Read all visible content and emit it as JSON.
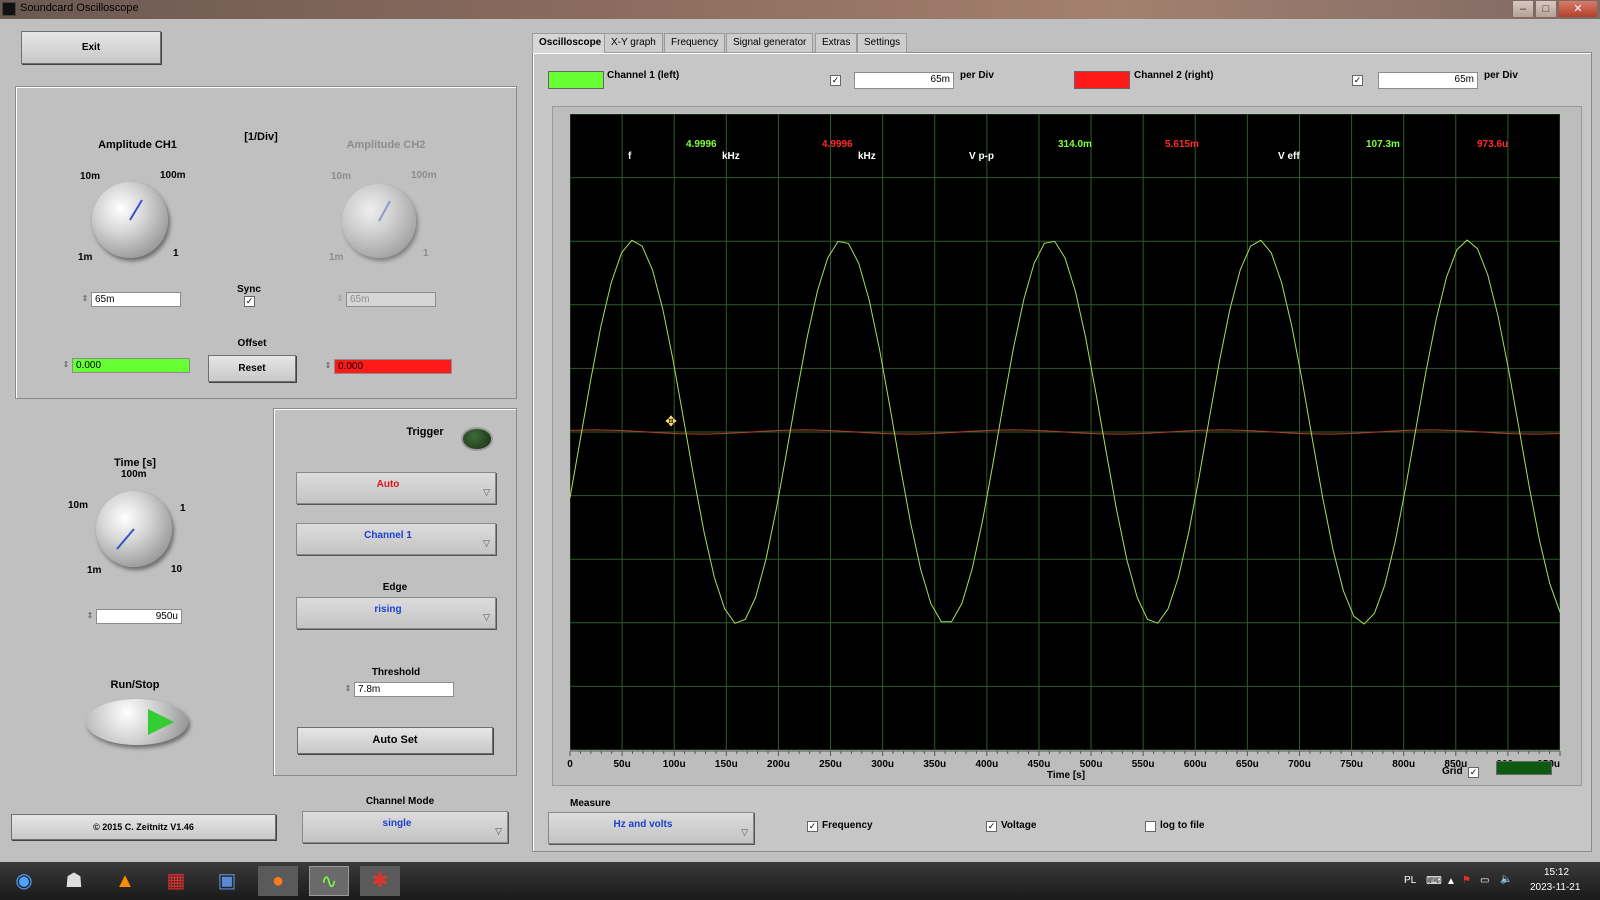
{
  "window": {
    "title": "Soundcard Oscilloscope"
  },
  "left": {
    "exit_label": "Exit",
    "amp_ch1": {
      "title": "Amplitude CH1",
      "t10m": "10m",
      "t100m": "100m",
      "t1m": "1m",
      "t1": "1",
      "value": "65m"
    },
    "per_div": "[1/Div]",
    "amp_ch2": {
      "title": "Amplitude CH2",
      "t10m": "10m",
      "t100m": "100m",
      "t1m": "1m",
      "t1": "1",
      "value": "65m"
    },
    "sync_label": "Sync",
    "offset_label": "Offset",
    "offset_ch1": "0.000",
    "offset_ch2": "0.000",
    "reset_label": "Reset",
    "time": {
      "title": "Time [s]",
      "t100m": "100m",
      "t10m": "10m",
      "t1": "1",
      "t1m": "1m",
      "t10": "10",
      "value": "950u"
    },
    "runstop_label": "Run/Stop",
    "copyright": "© 2015  C. Zeitnitz V1.46"
  },
  "trigger": {
    "title": "Trigger",
    "mode": "Auto",
    "channel": "Channel 1",
    "edge_label": "Edge",
    "edge": "rising",
    "threshold_label": "Threshold",
    "threshold": "7.8m",
    "autoset_label": "Auto Set",
    "channel_mode_label": "Channel Mode",
    "channel_mode": "single"
  },
  "tabs": [
    "Oscilloscope",
    "X-Y graph",
    "Frequency",
    "Signal generator",
    "Extras",
    "Settings"
  ],
  "channels": {
    "ch1_label": "Channel 1 (left)",
    "ch1_value": "65m",
    "ch2_label": "Channel 2 (right)",
    "ch2_value": "65m",
    "per_div": "per Div",
    "ch1_color": "#66ff33",
    "ch2_color": "#ff1a1a"
  },
  "scope": {
    "f_label": "f",
    "ch1_freq": "4.9996",
    "khz1": "kHz",
    "ch2_freq": "4.9996",
    "khz2": "kHz",
    "vpp_label": "V p-p",
    "ch1_vpp": "314.0m",
    "ch2_vpp": "5.615m",
    "veff_label": "V eff",
    "ch1_veff": "107.3m",
    "ch2_veff": "973.6u",
    "x_ticks": [
      "0",
      "50u",
      "100u",
      "150u",
      "200u",
      "250u",
      "300u",
      "350u",
      "400u",
      "450u",
      "500u",
      "550u",
      "600u",
      "650u",
      "700u",
      "750u",
      "800u",
      "850u",
      "900u",
      "950u"
    ],
    "x_label": "Time [s]",
    "grid_label": "Grid"
  },
  "measure": {
    "title": "Measure",
    "mode": "Hz and volts",
    "frequency_label": "Frequency",
    "voltage_label": "Voltage",
    "log_label": "log to file"
  },
  "chart_data": {
    "type": "line",
    "x_unit": "s",
    "xlim": [
      0,
      0.00095
    ],
    "ylim": [
      -0.26,
      0.26
    ],
    "series": [
      {
        "name": "Channel 1 (left)",
        "frequency_hz": 4999.6,
        "vpp": 0.314,
        "color": "#a6e05a"
      },
      {
        "name": "Channel 2 (right)",
        "vpp": 0.005615,
        "color": "#b5432e"
      }
    ]
  },
  "taskbar": {
    "lang": "PL",
    "time": "15:12",
    "date": "2023-11-21"
  }
}
